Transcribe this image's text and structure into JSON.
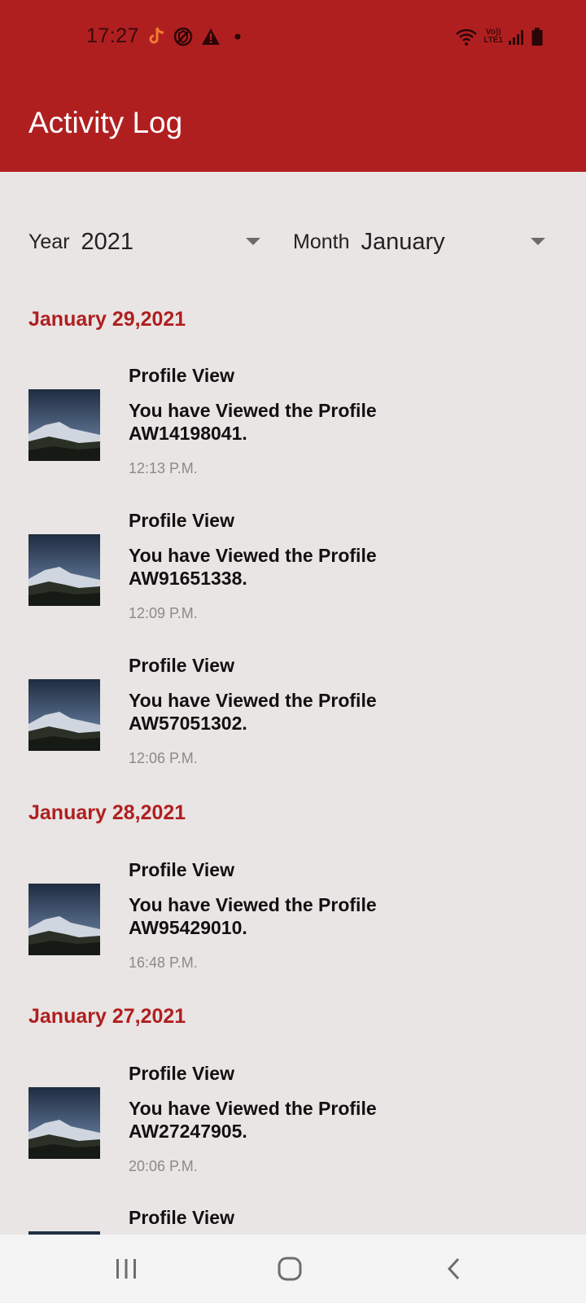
{
  "status_bar": {
    "time": "17:27",
    "network_label_top": "Vo))",
    "network_label_bottom": "LTE1"
  },
  "header": {
    "title": "Activity Log"
  },
  "filters": {
    "year_label": "Year",
    "year_value": "2021",
    "month_label": "Month",
    "month_value": "January"
  },
  "groups": [
    {
      "date": "January 29,2021",
      "entries": [
        {
          "type": "Profile View",
          "message": "You have Viewed the Profile AW14198041.",
          "time": "12:13 P.M."
        },
        {
          "type": "Profile View",
          "message": "You have Viewed the Profile AW91651338.",
          "time": "12:09 P.M."
        },
        {
          "type": "Profile View",
          "message": "You have Viewed the Profile AW57051302.",
          "time": "12:06 P.M."
        }
      ]
    },
    {
      "date": "January 28,2021",
      "entries": [
        {
          "type": "Profile View",
          "message": "You have Viewed the Profile AW95429010.",
          "time": "16:48 P.M."
        }
      ]
    },
    {
      "date": "January 27,2021",
      "entries": [
        {
          "type": "Profile View",
          "message": "You have Viewed the Profile AW27247905.",
          "time": "20:06 P.M."
        },
        {
          "type": "Profile View",
          "message": "",
          "time": ""
        }
      ]
    }
  ],
  "colors": {
    "header": "#b01f20",
    "background": "#e9e5e4",
    "date_header": "#b01f20"
  }
}
